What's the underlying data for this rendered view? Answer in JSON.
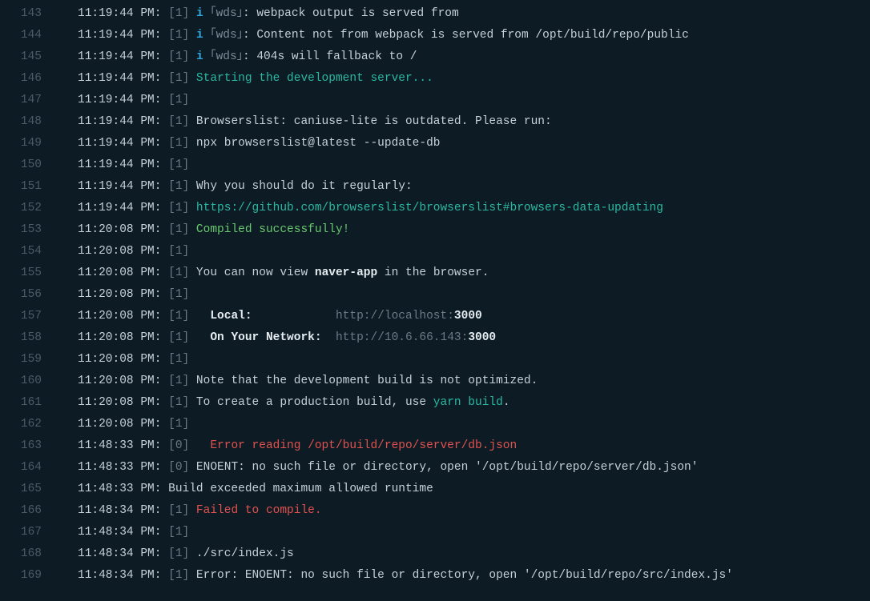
{
  "lines": [
    {
      "n": "143",
      "ts": "11:19:44 PM:",
      "idx": "[1]",
      "segs": [
        {
          "t": " ",
          "c": ""
        },
        {
          "t": "i ",
          "c": "info-i"
        },
        {
          "t": "｢",
          "c": "bracket"
        },
        {
          "t": "wds",
          "c": "wds"
        },
        {
          "t": "｣",
          "c": "bracket"
        },
        {
          "t": ": webpack output is served from",
          "c": "dim"
        }
      ]
    },
    {
      "n": "144",
      "ts": "11:19:44 PM:",
      "idx": "[1]",
      "segs": [
        {
          "t": " ",
          "c": ""
        },
        {
          "t": "i ",
          "c": "info-i"
        },
        {
          "t": "｢",
          "c": "bracket"
        },
        {
          "t": "wds",
          "c": "wds"
        },
        {
          "t": "｣",
          "c": "bracket"
        },
        {
          "t": ": Content not from webpack is served from /opt/build/repo/public",
          "c": "dim"
        }
      ]
    },
    {
      "n": "145",
      "ts": "11:19:44 PM:",
      "idx": "[1]",
      "segs": [
        {
          "t": " ",
          "c": ""
        },
        {
          "t": "i ",
          "c": "info-i"
        },
        {
          "t": "｢",
          "c": "bracket"
        },
        {
          "t": "wds",
          "c": "wds"
        },
        {
          "t": "｣",
          "c": "bracket"
        },
        {
          "t": ": 404s will fallback to /",
          "c": "dim"
        }
      ]
    },
    {
      "n": "146",
      "ts": "11:19:44 PM:",
      "idx": "[1]",
      "segs": [
        {
          "t": " Starting the development server...",
          "c": "teal"
        }
      ]
    },
    {
      "n": "147",
      "ts": "11:19:44 PM:",
      "idx": "[1]",
      "segs": []
    },
    {
      "n": "148",
      "ts": "11:19:44 PM:",
      "idx": "[1]",
      "segs": [
        {
          "t": " Browserslist: caniuse-lite is outdated. Please run:",
          "c": "dim"
        }
      ]
    },
    {
      "n": "149",
      "ts": "11:19:44 PM:",
      "idx": "[1]",
      "segs": [
        {
          "t": " npx browserslist@latest --update-db",
          "c": "dim"
        }
      ]
    },
    {
      "n": "150",
      "ts": "11:19:44 PM:",
      "idx": "[1]",
      "segs": []
    },
    {
      "n": "151",
      "ts": "11:19:44 PM:",
      "idx": "[1]",
      "segs": [
        {
          "t": " Why you should do it regularly:",
          "c": "dim"
        }
      ]
    },
    {
      "n": "152",
      "ts": "11:19:44 PM:",
      "idx": "[1]",
      "segs": [
        {
          "t": " https://github.com/browserslist/browserslist#browsers-data-updating",
          "c": "link"
        }
      ]
    },
    {
      "n": "153",
      "ts": "11:20:08 PM:",
      "idx": "[1]",
      "segs": [
        {
          "t": " Compiled successfully!",
          "c": "green"
        }
      ]
    },
    {
      "n": "154",
      "ts": "11:20:08 PM:",
      "idx": "[1]",
      "segs": []
    },
    {
      "n": "155",
      "ts": "11:20:08 PM:",
      "idx": "[1]",
      "segs": [
        {
          "t": " You can now view ",
          "c": "dim"
        },
        {
          "t": "naver-app",
          "c": "bold"
        },
        {
          "t": " in the browser.",
          "c": "dim"
        }
      ]
    },
    {
      "n": "156",
      "ts": "11:20:08 PM:",
      "idx": "[1]",
      "segs": []
    },
    {
      "n": "157",
      "ts": "11:20:08 PM:",
      "idx": "[1]",
      "segs": [
        {
          "t": "   ",
          "c": ""
        },
        {
          "t": "Local:",
          "c": "bold"
        },
        {
          "t": "            ",
          "c": ""
        },
        {
          "t": "http://localhost:",
          "c": "url-dim"
        },
        {
          "t": "3000",
          "c": "bold"
        }
      ]
    },
    {
      "n": "158",
      "ts": "11:20:08 PM:",
      "idx": "[1]",
      "segs": [
        {
          "t": "   ",
          "c": ""
        },
        {
          "t": "On Your Network:",
          "c": "bold"
        },
        {
          "t": "  ",
          "c": ""
        },
        {
          "t": "http://10.6.66.143:",
          "c": "url-dim"
        },
        {
          "t": "3000",
          "c": "bold"
        }
      ]
    },
    {
      "n": "159",
      "ts": "11:20:08 PM:",
      "idx": "[1]",
      "segs": []
    },
    {
      "n": "160",
      "ts": "11:20:08 PM:",
      "idx": "[1]",
      "segs": [
        {
          "t": " Note that the development build is not optimized.",
          "c": "dim"
        }
      ]
    },
    {
      "n": "161",
      "ts": "11:20:08 PM:",
      "idx": "[1]",
      "segs": [
        {
          "t": " To create a production build, use ",
          "c": "dim"
        },
        {
          "t": "yarn build",
          "c": "teal"
        },
        {
          "t": ".",
          "c": "dim"
        }
      ]
    },
    {
      "n": "162",
      "ts": "11:20:08 PM:",
      "idx": "[1]",
      "segs": []
    },
    {
      "n": "163",
      "ts": "11:48:33 PM:",
      "idx": "[0]",
      "segs": [
        {
          "t": "   Error reading /opt/build/repo/server/db.json",
          "c": "red"
        }
      ]
    },
    {
      "n": "164",
      "ts": "11:48:33 PM:",
      "idx": "[0]",
      "segs": [
        {
          "t": " ENOENT: no such file or directory, open '/opt/build/repo/server/db.json'",
          "c": "dim"
        }
      ]
    },
    {
      "n": "165",
      "ts": "11:48:33 PM:",
      "noidx": true,
      "segs": [
        {
          "t": " Build exceeded maximum allowed runtime",
          "c": "dim"
        }
      ]
    },
    {
      "n": "166",
      "ts": "11:48:34 PM:",
      "idx": "[1]",
      "segs": [
        {
          "t": " Failed to compile.",
          "c": "red"
        }
      ]
    },
    {
      "n": "167",
      "ts": "11:48:34 PM:",
      "idx": "[1]",
      "segs": []
    },
    {
      "n": "168",
      "ts": "11:48:34 PM:",
      "idx": "[1]",
      "segs": [
        {
          "t": " ./src/index.js",
          "c": "dim"
        }
      ]
    },
    {
      "n": "169",
      "ts": "11:48:34 PM:",
      "idx": "[1]",
      "segs": [
        {
          "t": " Error: ENOENT: no such file or directory, open '/opt/build/repo/src/index.js'",
          "c": "dim"
        }
      ]
    }
  ]
}
